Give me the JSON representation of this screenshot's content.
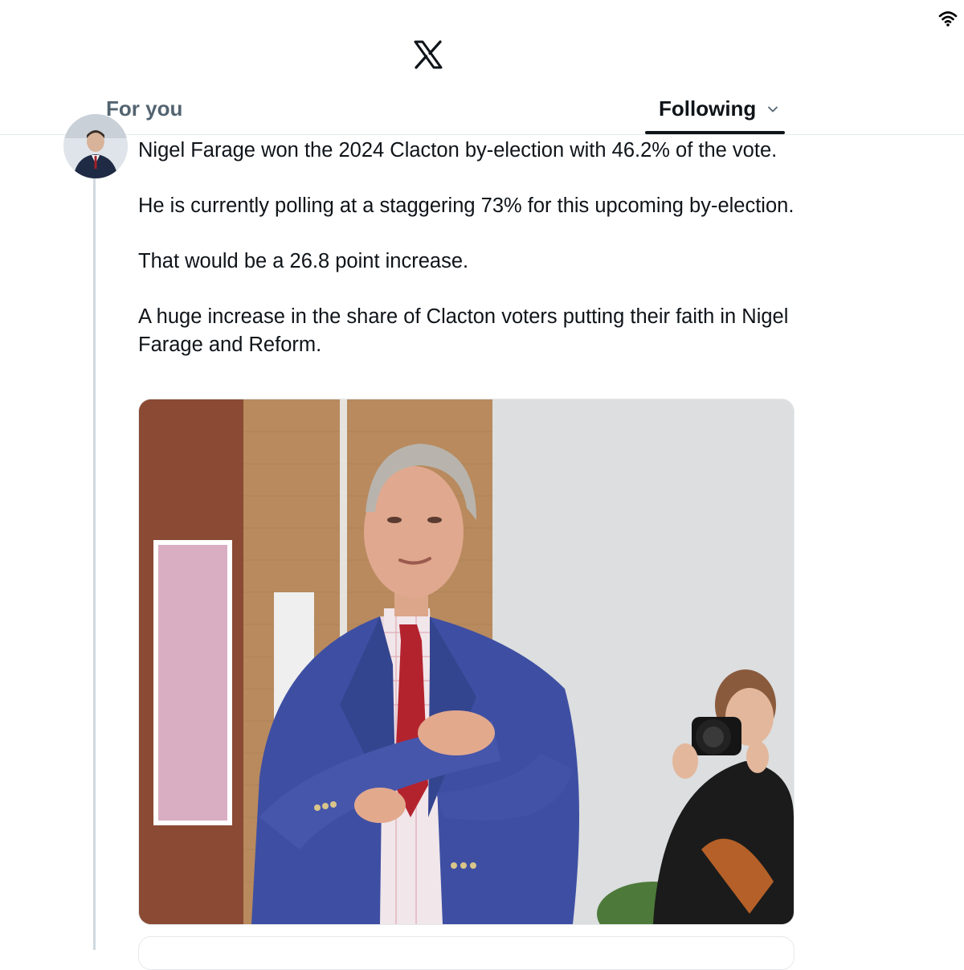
{
  "status_bar": {
    "wifi_icon": "wifi-icon"
  },
  "header": {
    "logo_icon": "x-logo-icon"
  },
  "tabs": [
    {
      "label": "For you",
      "active": false
    },
    {
      "label": "Following",
      "active": true,
      "icon": "chevron-down-icon"
    }
  ],
  "tweet": {
    "avatar": "avatar",
    "paragraphs": [
      "Nigel Farage won the 2024 Clacton by-election with 46.2% of the vote.",
      "He is currently polling at a staggering 73% for this upcoming by-election.",
      "That would be a 26.8 point increase.",
      "A huge increase in the share of Clacton voters putting their faith in Nigel Farage and Reform."
    ],
    "media": "photo-of-man-in-blue-jacket-with-photographer"
  },
  "colors": {
    "text": "#0f1419",
    "muted": "#536471",
    "border": "#e6e9ec",
    "thread_line": "#cfd9de"
  }
}
